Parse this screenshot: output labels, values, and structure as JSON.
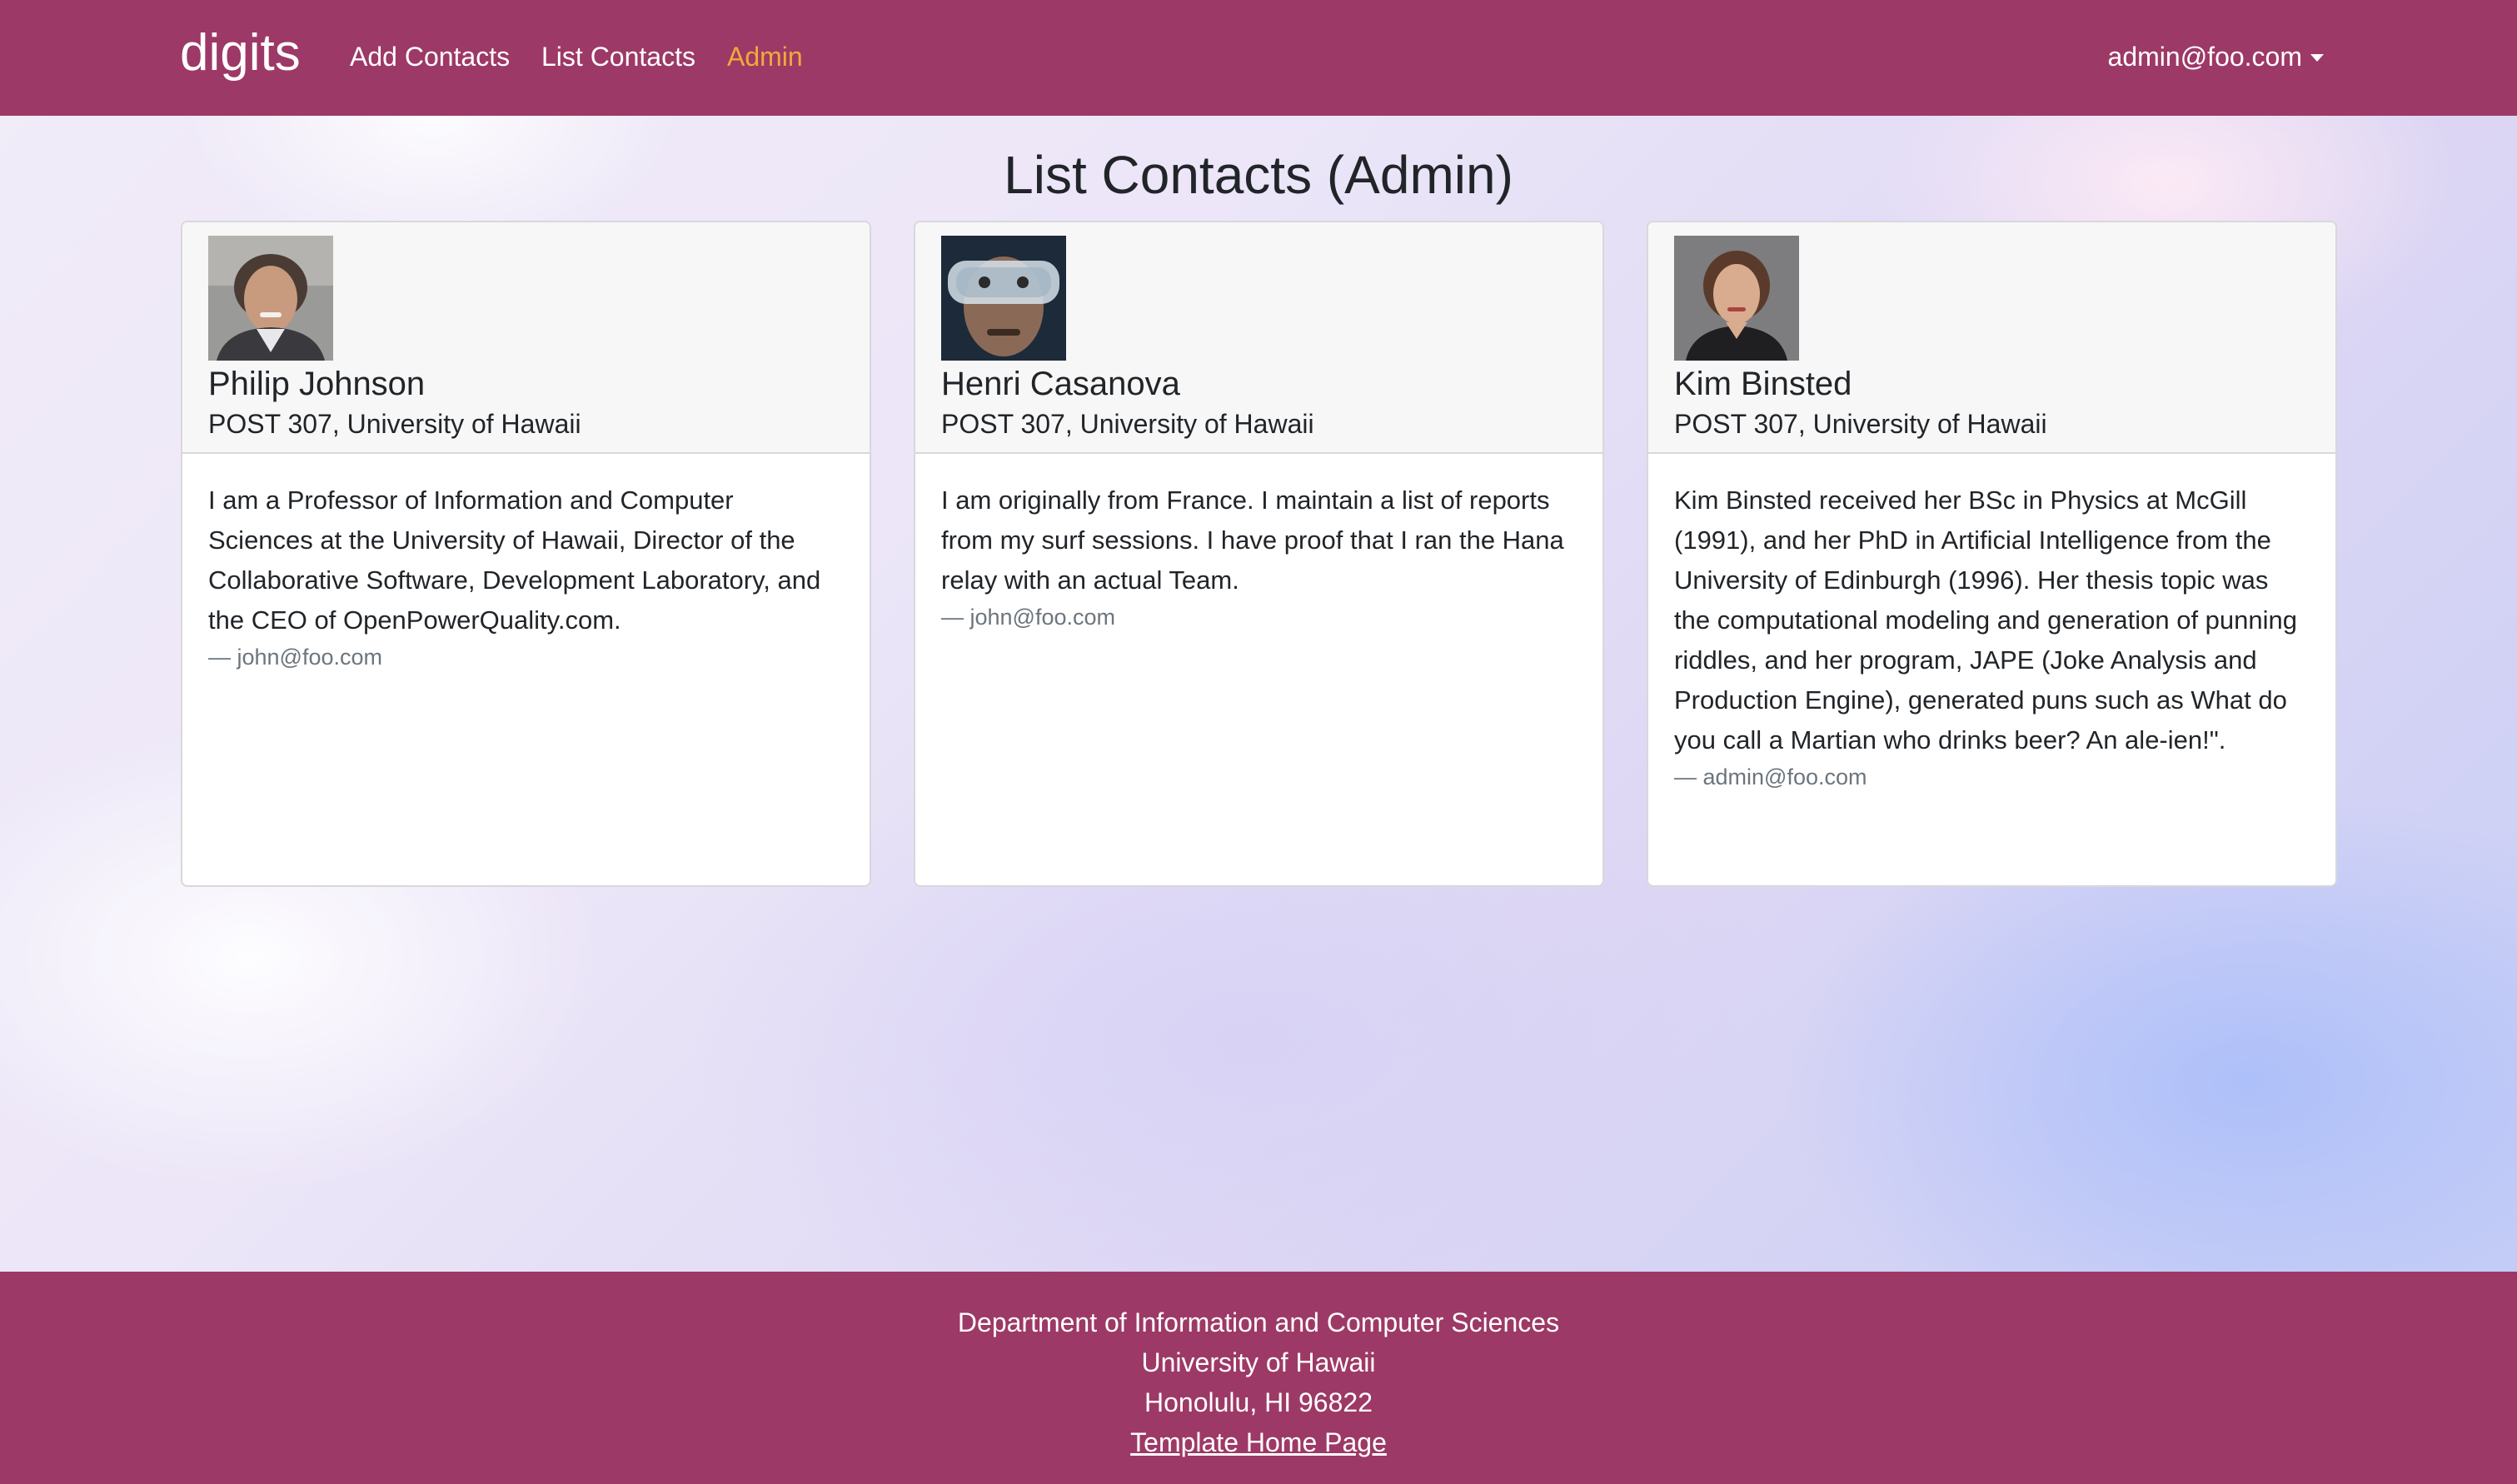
{
  "navbar": {
    "brand": "digits",
    "links": [
      {
        "label": "Add Contacts"
      },
      {
        "label": "List Contacts"
      },
      {
        "label": "Admin"
      }
    ],
    "user": "admin@foo.com",
    "active_color": "#f2a93b",
    "background_color": "#9d3966"
  },
  "page": {
    "title": "List Contacts (Admin)"
  },
  "contacts": [
    {
      "name": "Philip Johnson",
      "address": "POST 307, University of Hawaii",
      "description": "I am a Professor of Information and Computer Sciences at the University of Hawaii, Director of the Collaborative Software, Development Laboratory, and the CEO of OpenPowerQuality.com.",
      "owner": "— john@foo.com"
    },
    {
      "name": "Henri Casanova",
      "address": "POST 307, University of Hawaii",
      "description": "I am originally from France. I maintain a list of reports from my surf sessions. I have proof that I ran the Hana relay with an actual Team.",
      "owner": "— john@foo.com"
    },
    {
      "name": "Kim Binsted",
      "address": "POST 307, University of Hawaii",
      "description": "Kim Binsted received her BSc in Physics at McGill (1991), and her PhD in Artificial Intelligence from the University of Edinburgh (1996). Her thesis topic was the computational modeling and generation of punning riddles, and her program, JAPE (Joke Analysis and Production Engine), generated puns such as What do you call a Martian who drinks beer? An ale-ien!\".",
      "owner": "— admin@foo.com"
    }
  ],
  "footer": {
    "line1": "Department of Information and Computer Sciences",
    "line2": "University of Hawaii",
    "line3": "Honolulu, HI 96822",
    "link": "Template Home Page"
  }
}
